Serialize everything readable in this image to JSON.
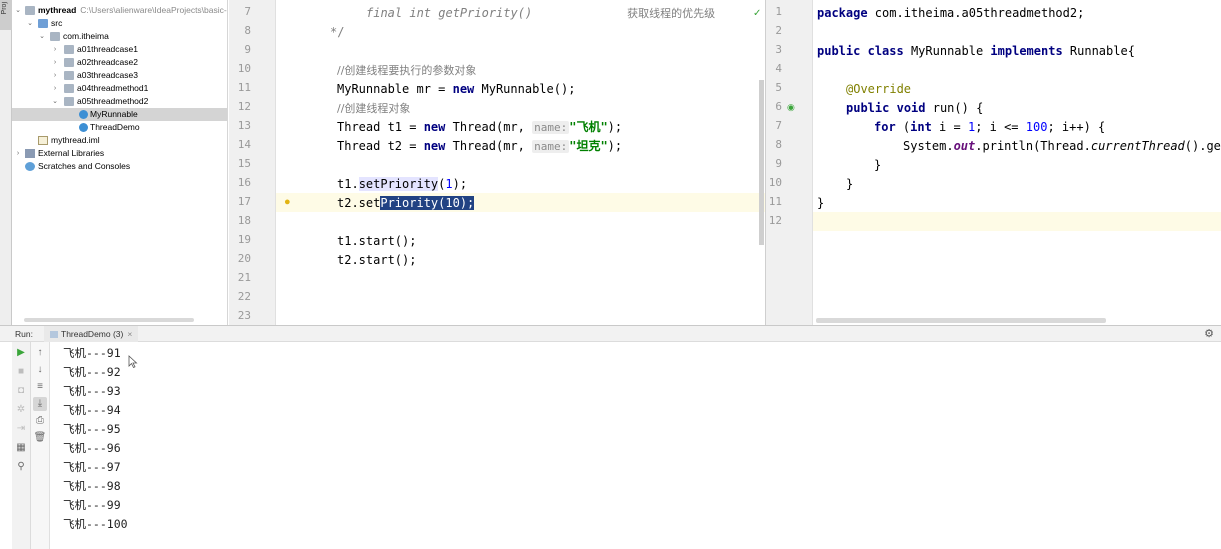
{
  "project": {
    "tool_tab": "Proj",
    "root": {
      "name": "mythread",
      "path": "C:\\Users\\alienware\\IdeaProjects\\basic-"
    },
    "rows": [
      {
        "label": "src"
      },
      {
        "label": "com.itheima"
      },
      {
        "label": "a01threadcase1"
      },
      {
        "label": "a02threadcase2"
      },
      {
        "label": "a03threadcase3"
      },
      {
        "label": "a04threadmethod1"
      },
      {
        "label": "a05threadmethod2"
      },
      {
        "label": "MyRunnable"
      },
      {
        "label": "ThreadDemo"
      },
      {
        "label": "mythread.iml"
      },
      {
        "label": "External Libraries"
      },
      {
        "label": "Scratches and Consoles"
      }
    ]
  },
  "editor_left": {
    "line_numbers": [
      "7",
      "8",
      "9",
      "10",
      "11",
      "12",
      "13",
      "14",
      "15",
      "16",
      "17",
      "18",
      "19",
      "20",
      "21",
      "22",
      "23"
    ],
    "comment_line7_code": "final int getPriority()",
    "comment_line7_desc": "获取线程的优先级",
    "comment_end": "*/",
    "comment_create_target": "//创建线程要执行的参数对象",
    "comment_create_thread": "//创建线程对象",
    "mr_var": "MyRunnable mr = ",
    "mr_new": "new",
    "mr_ctor": " MyRunnable();",
    "thread_t1": "Thread t1 = ",
    "thread_t2": "Thread t2 = ",
    "thread_new": "new",
    "thread_ctor": " Thread(mr, ",
    "hint_name": "name:",
    "str_plane": "\"飞机\"",
    "str_tank": "\"坦克\"",
    "close_paren": ");",
    "t1_prefix": "t1.",
    "t1_method": "setPriority",
    "t1_open": "(",
    "t1_num": "1",
    "t1_close": ");",
    "t2_prefix": "t2.set",
    "t2_selected": "Priority(10);",
    "start_t1": "t1.start();",
    "start_t2": "t2.start();"
  },
  "editor_right": {
    "line_numbers": [
      "1",
      "2",
      "3",
      "4",
      "5",
      "6",
      "7",
      "8",
      "9",
      "10",
      "11",
      "12"
    ],
    "pkg_kw": "package",
    "pkg_name": " com.itheima.a05threadmethod2;",
    "cls_public": "public",
    "cls_class": "class",
    "cls_name": " MyRunnable ",
    "cls_implements": "implements",
    "cls_iface": " Runnable{",
    "override": "@Override",
    "run_public": "public",
    "run_void": "void",
    "run_sig": " run() {",
    "for_kw": "for",
    "for_open": " (",
    "for_int": "int",
    "for_i": " i = ",
    "for_one": "1",
    "for_cond": "; i <= ",
    "for_hundred": "100",
    "for_tail": "; i++) {",
    "println_a": "System.",
    "println_out": "out",
    "println_b": ".println(Thread.",
    "println_ct": "currentThread",
    "println_c": "().get",
    "close_inner": "}",
    "close_run": "}",
    "close_class": "}"
  },
  "run_panel": {
    "label": "Run:",
    "tab": "ThreadDemo (3)",
    "tab_close": "×",
    "output": [
      "飞机---91",
      "飞机---92",
      "飞机---93",
      "飞机---94",
      "飞机---95",
      "飞机---96",
      "飞机---97",
      "飞机---98",
      "飞机---99",
      "飞机---100"
    ]
  }
}
